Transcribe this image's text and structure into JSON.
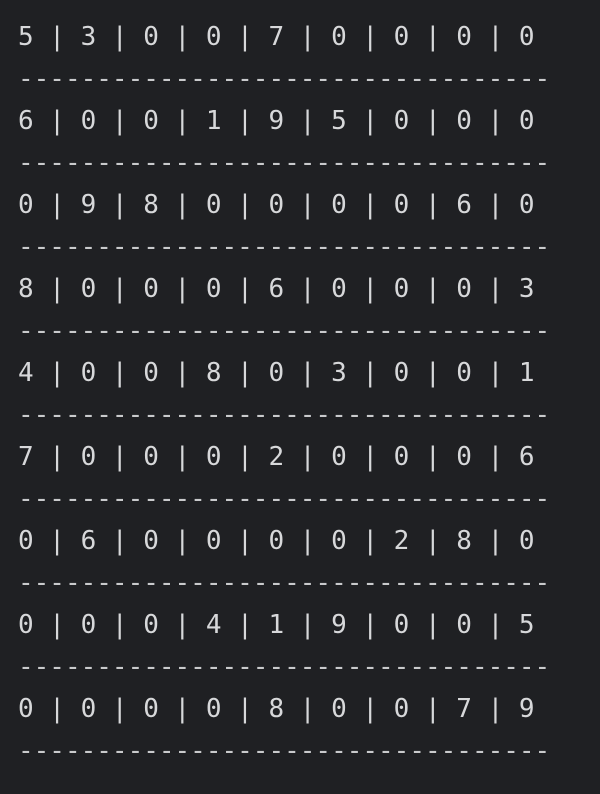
{
  "terminal": {
    "separator": "----------------------------------",
    "rows": [
      "5 | 3 | 0 | 0 | 7 | 0 | 0 | 0 | 0",
      "6 | 0 | 0 | 1 | 9 | 5 | 0 | 0 | 0",
      "0 | 9 | 8 | 0 | 0 | 0 | 0 | 6 | 0",
      "8 | 0 | 0 | 0 | 6 | 0 | 0 | 0 | 3",
      "4 | 0 | 0 | 8 | 0 | 3 | 0 | 0 | 1",
      "7 | 0 | 0 | 0 | 2 | 0 | 0 | 0 | 6",
      "0 | 6 | 0 | 0 | 0 | 0 | 2 | 8 | 0",
      "0 | 0 | 0 | 4 | 1 | 9 | 0 | 0 | 5",
      "0 | 0 | 0 | 0 | 8 | 0 | 0 | 7 | 9"
    ]
  }
}
